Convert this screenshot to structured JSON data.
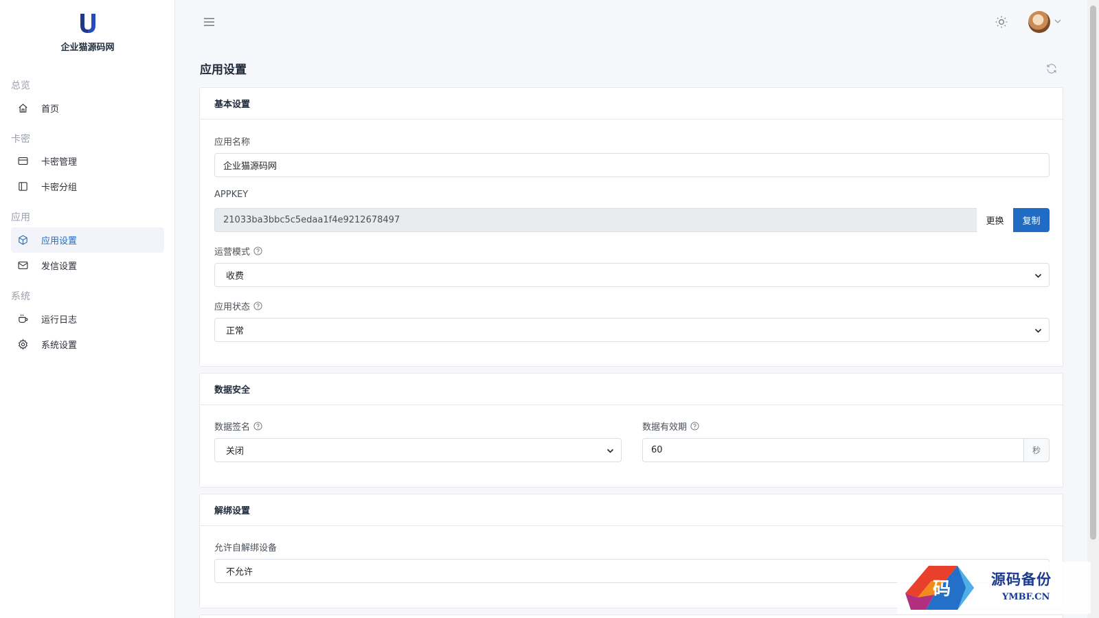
{
  "brand": {
    "name": "企业猫源码网"
  },
  "sidebar": {
    "sections": [
      {
        "title": "总览",
        "items": [
          {
            "label": "首页",
            "icon": "home-icon"
          }
        ]
      },
      {
        "title": "卡密",
        "items": [
          {
            "label": "卡密管理",
            "icon": "credit-card-icon"
          },
          {
            "label": "卡密分组",
            "icon": "sidebar-layout-icon"
          }
        ]
      },
      {
        "title": "应用",
        "items": [
          {
            "label": "应用设置",
            "icon": "box-icon",
            "active": true
          },
          {
            "label": "发信设置",
            "icon": "mail-icon"
          }
        ]
      },
      {
        "title": "系统",
        "items": [
          {
            "label": "运行日志",
            "icon": "coffee-cup-icon"
          },
          {
            "label": "系统设置",
            "icon": "gear-icon"
          }
        ]
      }
    ]
  },
  "page": {
    "title": "应用设置"
  },
  "basic": {
    "title": "基本设置",
    "app_name_label": "应用名称",
    "app_name_value": "企业猫源码网",
    "appkey_label": "APPKEY",
    "appkey_value": "21033ba3bbc5c5edaa1f4e9212678497",
    "change_label": "更换",
    "copy_label": "复制",
    "mode_label": "运营模式",
    "mode_value": "收费",
    "status_label": "应用状态",
    "status_value": "正常"
  },
  "security": {
    "title": "数据安全",
    "sign_label": "数据签名",
    "sign_value": "关闭",
    "validity_label": "数据有效期",
    "validity_value": "60",
    "validity_unit": "秒"
  },
  "unbind": {
    "title": "解绑设置",
    "allow_label": "允许自解绑设备",
    "allow_value": "不允许"
  },
  "watermark": {
    "title": "源码备份",
    "url": "YMBF.CN",
    "glyph": "码"
  },
  "colors": {
    "primary": "#206bc4",
    "sidebar_active_bg": "#f2f4f9"
  }
}
